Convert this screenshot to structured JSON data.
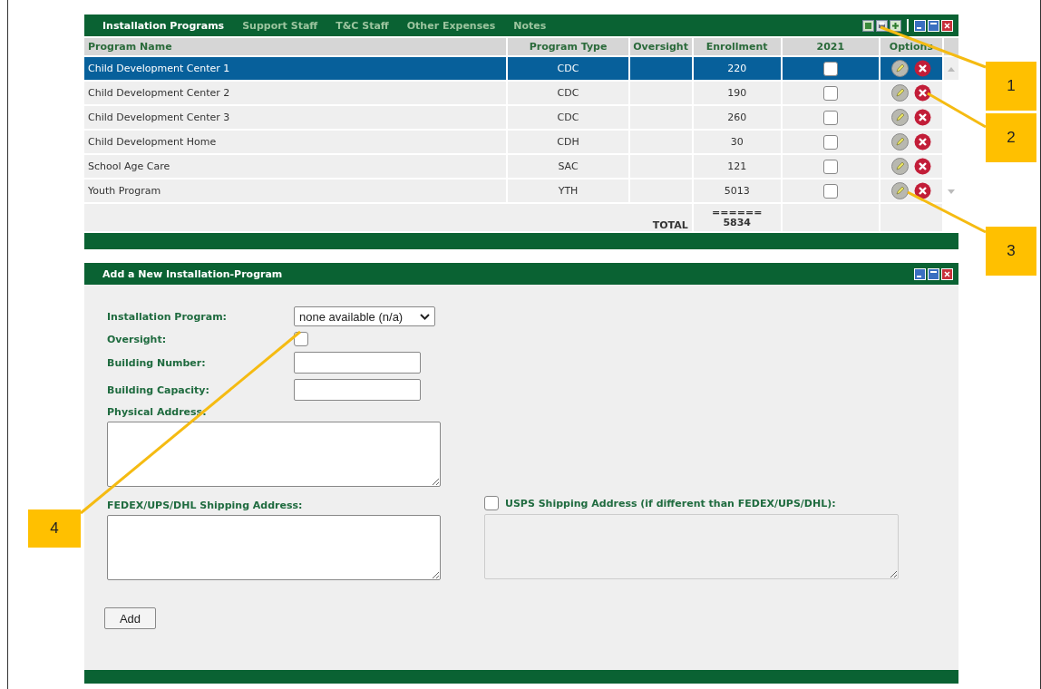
{
  "tabs": [
    {
      "label": "Installation Programs",
      "selected": true
    },
    {
      "label": "Support Staff",
      "selected": false
    },
    {
      "label": "T&C Staff",
      "selected": false
    },
    {
      "label": "Other Expenses",
      "selected": false
    },
    {
      "label": "Notes",
      "selected": false
    }
  ],
  "table": {
    "columns": [
      "Program Name",
      "Program Type",
      "Oversight",
      "Enrollment",
      "2021",
      "Options"
    ],
    "rows": [
      {
        "name": "Child Development Center 1",
        "type": "CDC",
        "enrollment": "220",
        "checked": false,
        "selected": true
      },
      {
        "name": "Child Development Center 2",
        "type": "CDC",
        "enrollment": "190",
        "checked": false,
        "selected": false
      },
      {
        "name": "Child Development Center 3",
        "type": "CDC",
        "enrollment": "260",
        "checked": false,
        "selected": false
      },
      {
        "name": "Child Development Home",
        "type": "CDH",
        "enrollment": "30",
        "checked": false,
        "selected": false
      },
      {
        "name": "School Age Care",
        "type": "SAC",
        "enrollment": "121",
        "checked": false,
        "selected": false
      },
      {
        "name": "Youth Program",
        "type": "YTH",
        "enrollment": "5013",
        "checked": false,
        "selected": false
      }
    ],
    "total_label": "TOTAL",
    "total_rule": "======",
    "total": "5834"
  },
  "form": {
    "title": "Add a New Installation-Program",
    "program_label": "Installation Program:",
    "program_value": "none available (n/a)",
    "oversight_label": "Oversight:",
    "oversight_checked": false,
    "building_number_label": "Building Number:",
    "building_capacity_label": "Building Capacity:",
    "physical_address_label": "Physical Address:",
    "shipping_label": "FEDEX/UPS/DHL Shipping Address:",
    "usps_label": "USPS Shipping Address (if different than FEDEX/UPS/DHL):",
    "usps_checked": false,
    "add_button": "Add"
  },
  "callouts": [
    "1",
    "2",
    "3",
    "4"
  ]
}
